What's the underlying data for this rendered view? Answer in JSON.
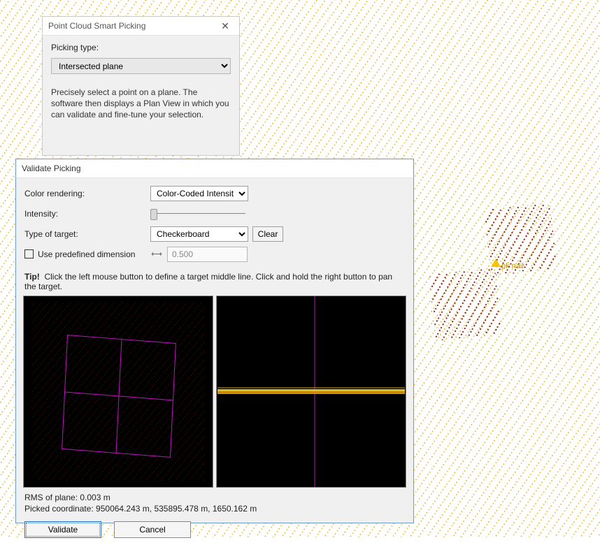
{
  "smartPicking": {
    "title": "Point Cloud Smart Picking",
    "pickingTypeLabel": "Picking type:",
    "pickingTypeValue": "Intersected plane",
    "description": "Precisely select a point on a plane. The software then displays a Plan View in which you can validate and fine-tune your selection."
  },
  "validate": {
    "title": "Validate Picking",
    "colorRenderingLabel": "Color rendering:",
    "colorRenderingValue": "Color-Coded Intensity",
    "intensityLabel": "Intensity:",
    "typeOfTargetLabel": "Type of target:",
    "typeOfTargetValue": "Checkerboard",
    "clearLabel": "Clear",
    "usePredefinedLabel": "Use predefined dimension",
    "predefinedValue": "0.500",
    "tipPrefix": "Tip!",
    "tipText": "Click the left mouse button to define a target middle line. Click and hold the right button to pan the target.",
    "rmsText": "RMS of plane: 0.003 m",
    "pickedText": "Picked coordinate: 950064.243 m, 535895.478 m, 1650.162 m",
    "validateBtn": "Validate",
    "cancelBtn": "Cancel"
  },
  "annotation": {
    "label": "pk nail"
  }
}
